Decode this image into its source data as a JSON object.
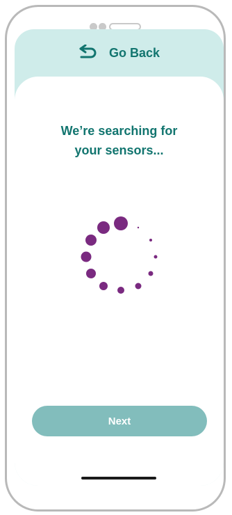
{
  "header": {
    "back_label": "Go Back",
    "back_icon": "return-arrow-icon"
  },
  "main": {
    "title_line1": "We’re searching for",
    "title_line2": "your sensors...",
    "spinner_icon": "loading-spinner-icon"
  },
  "footer": {
    "next_label": "Next"
  },
  "colors": {
    "accent": "#12756f",
    "header_bg": "#cfecea",
    "button_bg": "#82bdbc",
    "spinner": "#7a2a80"
  }
}
